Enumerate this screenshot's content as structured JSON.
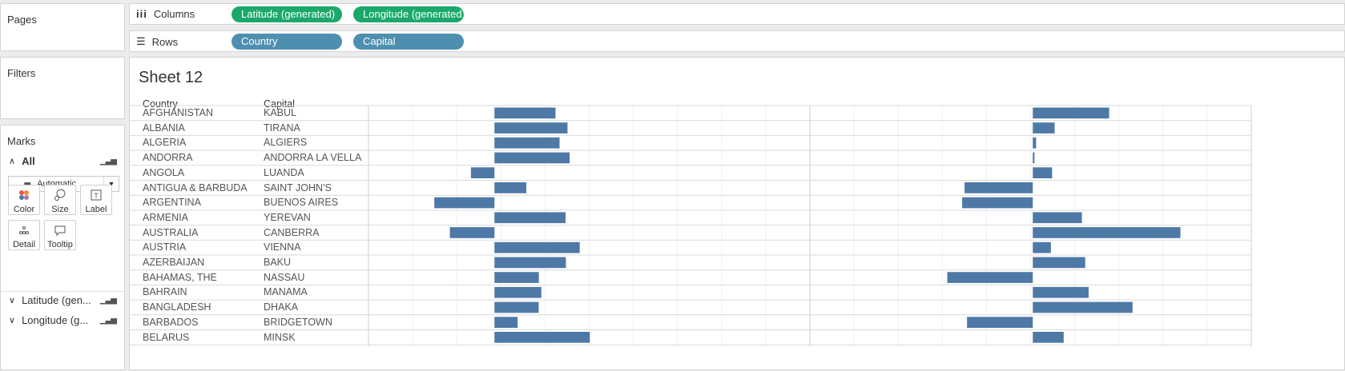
{
  "pages_panel": {
    "title": "Pages"
  },
  "filters_panel": {
    "title": "Filters"
  },
  "columns_shelf": {
    "label": "Columns",
    "pills": [
      "Latitude (generated)",
      "Longitude (generated)"
    ]
  },
  "rows_shelf": {
    "label": "Rows",
    "pills": [
      "Country",
      "Capital"
    ]
  },
  "marks": {
    "title": "Marks",
    "all_label": "All",
    "mark_type": "Automatic",
    "buttons": [
      "Color",
      "Size",
      "Label",
      "Detail",
      "Tooltip"
    ],
    "sub_cards": [
      "Latitude (gen...",
      "Longitude (g..."
    ]
  },
  "sheet": {
    "title": "Sheet 12",
    "col_headers": {
      "country": "Country",
      "capital": "Capital"
    }
  },
  "colors": {
    "bar": "#4e79a7",
    "green_pill": "#1aa86b",
    "blue_pill": "#4e8fb0"
  },
  "chart_data": {
    "type": "bar",
    "orientation": "horizontal",
    "categories": [
      "AFGHANISTAN",
      "ALBANIA",
      "ALGERIA",
      "ANDORRA",
      "ANGOLA",
      "ANTIGUA & BARBUDA",
      "ARGENTINA",
      "ARMENIA",
      "AUSTRALIA",
      "AUSTRIA",
      "AZERBAIJAN",
      "BAHAMAS, THE",
      "BAHRAIN",
      "BANGLADESH",
      "BARBADOS",
      "BELARUS"
    ],
    "capitals": [
      "KABUL",
      "TIRANA",
      "ALGIERS",
      "ANDORRA LA VELLA",
      "LUANDA",
      "SAINT JOHN'S",
      "BUENOS AIRES",
      "YEREVAN",
      "CANBERRA",
      "VIENNA",
      "BAKU",
      "NASSAU",
      "MANAMA",
      "DHAKA",
      "BRIDGETOWN",
      "MINSK"
    ],
    "series": [
      {
        "name": "Latitude (generated)",
        "values": [
          34.5,
          41.3,
          36.8,
          42.5,
          -13.3,
          18.0,
          -34.0,
          40.2,
          -25.2,
          48.2,
          40.4,
          25.1,
          26.5,
          25.0,
          13.1,
          53.9
        ]
      },
      {
        "name": "Longitude (generated)",
        "values": [
          69.2,
          19.8,
          3.0,
          1.5,
          17.5,
          -61.8,
          -64.0,
          44.5,
          133.8,
          16.4,
          47.5,
          -77.5,
          50.6,
          90.4,
          -59.6,
          28.0
        ]
      }
    ],
    "xlim_lat": [
      -71.2,
      178.3
    ],
    "xlim_lon": [
      -202,
      198
    ],
    "grid": true
  }
}
